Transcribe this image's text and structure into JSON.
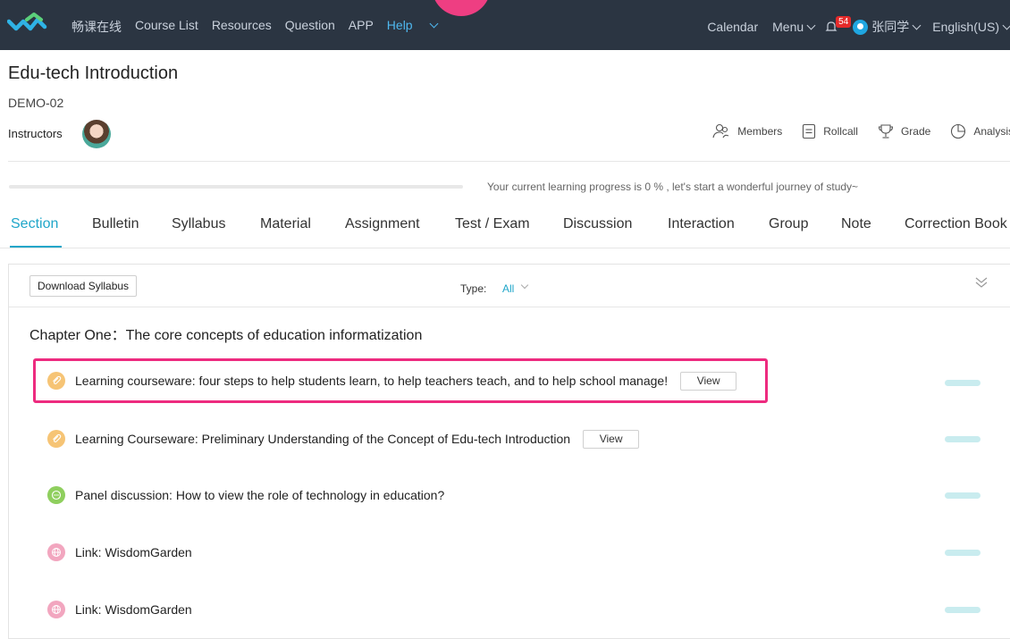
{
  "colors": {
    "nav_bg": "#2b3542",
    "accent": "#1fa6c9",
    "highlight": "#ed2b7f",
    "badge": "#e52a2a"
  },
  "nav": {
    "logo_icon": "logo-icon",
    "items": [
      {
        "label": "畅课在线"
      },
      {
        "label": "Course List"
      },
      {
        "label": "Resources"
      },
      {
        "label": "Question"
      },
      {
        "label": "APP"
      }
    ],
    "help": "Help",
    "calendar": "Calendar",
    "menu": "Menu",
    "notification_count": "54",
    "user": "张同学",
    "language": "English(US)"
  },
  "course": {
    "title": "Edu-tech Introduction",
    "code": "DEMO-02",
    "instructors_label": "Instructors"
  },
  "tools": {
    "members": "Members",
    "rollcall": "Rollcall",
    "grade": "Grade",
    "analysis": "Analysis"
  },
  "progress": {
    "value": 0,
    "text": "Your current learning progress is 0 % , let's start a wonderful journey of study~"
  },
  "tabs": [
    {
      "label": "Section",
      "active": true
    },
    {
      "label": "Bulletin"
    },
    {
      "label": "Syllabus"
    },
    {
      "label": "Material"
    },
    {
      "label": "Assignment"
    },
    {
      "label": "Test / Exam"
    },
    {
      "label": "Discussion"
    },
    {
      "label": "Interaction"
    },
    {
      "label": "Group"
    },
    {
      "label": "Note"
    },
    {
      "label": "Correction Book"
    }
  ],
  "panel": {
    "download_label": "Download Syllabus",
    "type_label": "Type:",
    "type_value": "All"
  },
  "chapter": {
    "title": "Chapter One：The core concepts of education informatization",
    "items": [
      {
        "text": "Learning courseware: four steps to help students learn, to help teachers teach, and to help school manage!",
        "button": "View",
        "icon": "courseware-icon"
      },
      {
        "text": "Learning Courseware: Preliminary Understanding of the Concept of Edu-tech Introduction",
        "button": "View",
        "icon": "courseware-icon"
      },
      {
        "text": "Panel discussion: How to view the role of technology in education?",
        "icon": "discussion-icon"
      },
      {
        "text": "Link: WisdomGarden",
        "icon": "link-icon"
      },
      {
        "text": "Link: WisdomGarden",
        "icon": "link-icon"
      }
    ]
  }
}
